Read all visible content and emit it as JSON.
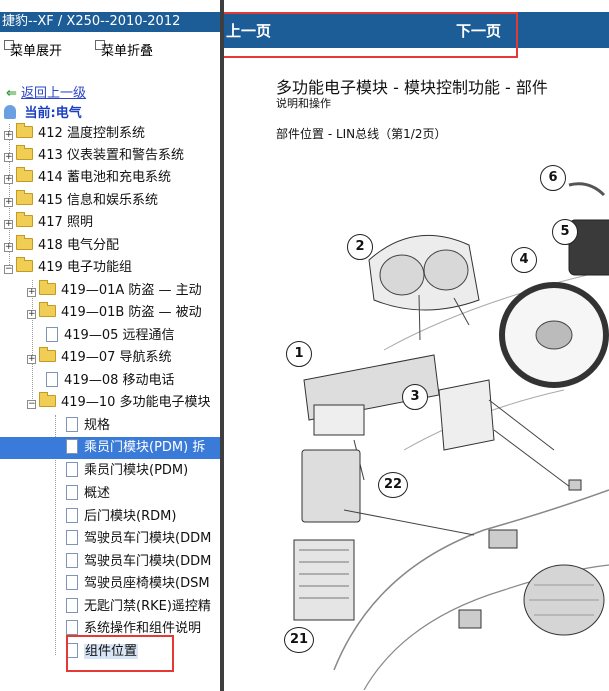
{
  "left": {
    "title": "捷豹--XF / X250--2010-2012",
    "menu": {
      "expand": "菜单展开",
      "collapse": "菜单折叠"
    },
    "back_label": "返回上一级",
    "current_label": "当前:电气",
    "tree": [
      {
        "label": "412 温度控制系统"
      },
      {
        "label": "413 仪表装置和警告系统"
      },
      {
        "label": "414 蓄电池和充电系统"
      },
      {
        "label": "415 信息和娱乐系统"
      },
      {
        "label": "417 照明"
      },
      {
        "label": "418 电气分配"
      },
      {
        "label": "419 电子功能组"
      },
      {
        "label": "419—01A 防盗 — 主动"
      },
      {
        "label": "419—01B 防盗 — 被动"
      },
      {
        "label": "419—05 远程通信"
      },
      {
        "label": "419—07 导航系统"
      },
      {
        "label": "419—08 移动电话"
      },
      {
        "label": "419—10 多功能电子模块"
      },
      {
        "label": "规格"
      },
      {
        "label": "乘员门模块(PDM) 拆"
      },
      {
        "label": "乘员门模块(PDM)"
      },
      {
        "label": "概述"
      },
      {
        "label": "后门模块(RDM)"
      },
      {
        "label": "驾驶员车门模块(DDM"
      },
      {
        "label": "驾驶员车门模块(DDM"
      },
      {
        "label": "驾驶员座椅模块(DSM"
      },
      {
        "label": "无匙门禁(RKE)遥控精"
      },
      {
        "label": "系统操作和组件说明"
      },
      {
        "label": "组件位置"
      }
    ]
  },
  "right": {
    "prev_label": "上一页",
    "next_label": "下一页",
    "doc_title": "多功能电子模块 - 模块控制功能 - 部件",
    "doc_subtitle": "说明和操作",
    "doc_location": "部件位置 - LIN总线（第1/2页）",
    "callouts": [
      "6",
      "2",
      "5",
      "4",
      "1",
      "3",
      "22",
      "21"
    ]
  },
  "colors": {
    "titlebar": "#1d5d97",
    "highlight_box": "#e53935",
    "selection": "#3a7ad8"
  }
}
